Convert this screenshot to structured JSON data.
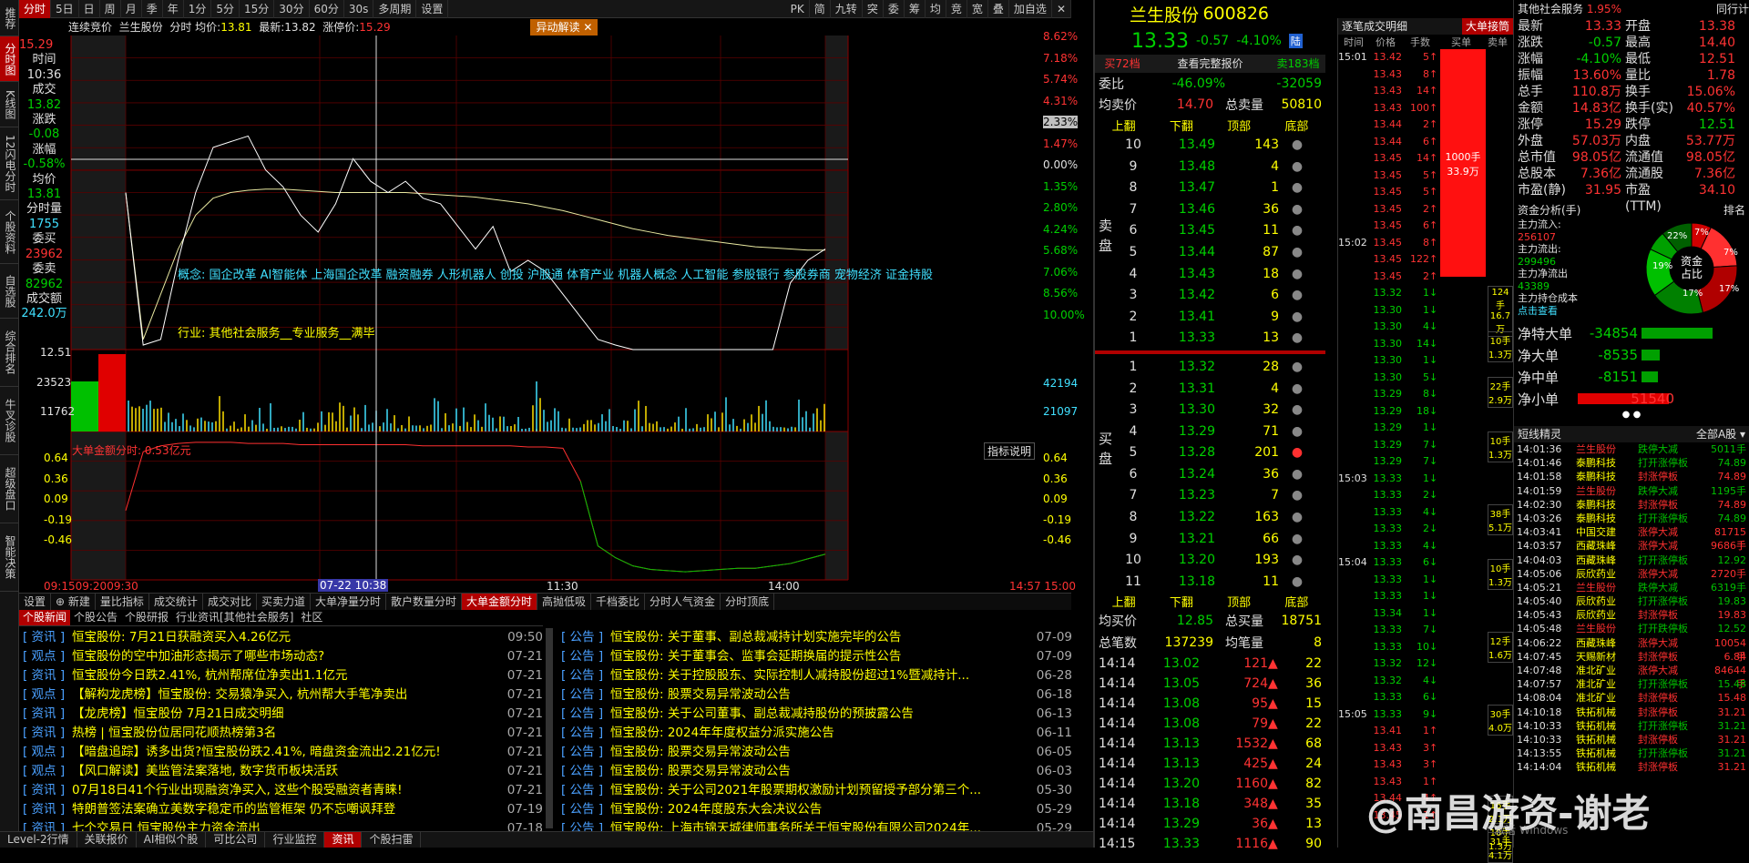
{
  "left_tabs": [
    "推荐",
    "分时图",
    "K线图",
    "12闪电分时",
    "个股资料",
    "自选股",
    "综合排名",
    "牛叉诊股",
    "超级盘口",
    "智能决策"
  ],
  "top_tabs": [
    "分时",
    "5日",
    "日",
    "周",
    "月",
    "季",
    "年",
    "1分",
    "5分",
    "15分",
    "30分",
    "60分",
    "30s",
    "多周期",
    "设置"
  ],
  "top_right_tabs": [
    "PK",
    "简",
    "九转",
    "突",
    "委",
    "筹",
    "均",
    "竞",
    "宽",
    "叠",
    "加自选"
  ],
  "infobar": {
    "mode": "连续竞价",
    "name": "兰生股份",
    "chart_kind": "分时",
    "avg_label": "均价:",
    "avg": "13.81",
    "last_label": "最新:",
    "last": "13.82",
    "limitup_label": "涨停价:",
    "limitup": "15.29",
    "alert": "异动解读"
  },
  "left_panel": {
    "time_label": "时间",
    "time": "10:36",
    "close_label": "成交",
    "close": "13.82",
    "chg_label": "涨跌",
    "chg": "-0.08",
    "pct_label": "涨幅",
    "pct": "-0.58%",
    "avg_label": "均价",
    "avg": "13.81",
    "vol_label": "分时量",
    "vol": "1755",
    "buy_label": "委买",
    "buy": "23962",
    "sell_label": "委卖",
    "sell": "82962",
    "amt_label": "成交额",
    "amt": "242.0万"
  },
  "price_axis_left": [
    "15.29",
    "12.51"
  ],
  "price_axis_right": [
    "8.62%",
    "7.18%",
    "5.74%",
    "4.31%",
    "2.33%",
    "1.47%",
    "0.00%",
    "1.35%",
    "2.80%",
    "4.24%",
    "5.68%",
    "7.06%",
    "8.56%",
    "10.00%"
  ],
  "vol_axis_left": [
    "23523",
    "11762"
  ],
  "vol_axis_right": [
    "42194",
    "21097"
  ],
  "concept_text": "概念: 国企改革 AI智能体 上海国企改革 融资融券 人形机器人 创投 沪股通 体育产业 机器人概念 人工智能 参股银行 参股券商 宠物经济 证金持股",
  "industry_text": "行业: 其他社会服务__专业服务__满毕",
  "indicator": {
    "title": "大单金额分时: 0.53亿元",
    "button": "指标说明",
    "left_axis": [
      "0.64",
      "0.36",
      "0.09",
      "-0.19",
      "-0.46"
    ],
    "right_axis": [
      "0.64",
      "0.36",
      "0.09",
      "-0.19",
      "-0.46"
    ]
  },
  "time_axis": {
    "start": "09:15",
    "t2": "09:20",
    "t3": "09:30",
    "cursor": "07-22 10:38",
    "t5": "11:30",
    "t6": "14:00",
    "end": "14:57",
    "end2": "15:00"
  },
  "sub_tabs": [
    "设置",
    "新建",
    "量比指标",
    "成交统计",
    "成交对比",
    "买卖力道",
    "大单净量分时",
    "散户数量分时",
    "大单金额分时",
    "高抛低吸",
    "千档委比",
    "分时人气资金",
    "分时顶底"
  ],
  "news_tabs": [
    "个股新闻",
    "个股公告",
    "个股研报",
    "行业资讯[其他社会服务]",
    "社区"
  ],
  "news_left": [
    {
      "tag": "[ 资讯 ]",
      "text": "恒宝股份: 7月21日获融资买入4.26亿元",
      "date": "09:50"
    },
    {
      "tag": "[ 观点 ]",
      "text": "恒宝股份的空中加油形态揭示了哪些市场动态?",
      "date": "07-21"
    },
    {
      "tag": "[ 资讯 ]",
      "text": "恒宝股份今日跌2.41%, 杭州帮席位净卖出1.1亿元",
      "date": "07-21"
    },
    {
      "tag": "[ 观点 ]",
      "text": "【解构龙虎榜】恒宝股份: 交易猿净买入, 杭州帮大手笔净卖出",
      "date": "07-21"
    },
    {
      "tag": "[ 资讯 ]",
      "text": "【龙虎榜】恒宝股份 7月21日成交明细",
      "date": "07-21"
    },
    {
      "tag": "[ 资讯 ]",
      "text": "热榜 | 恒宝股份位居同花顺热榜第3名",
      "date": "07-21"
    },
    {
      "tag": "[ 观点 ]",
      "text": "【暗盘追踪】诱多出货?恒宝股份跌2.41%, 暗盘资金流出2.21亿元!",
      "date": "07-21"
    },
    {
      "tag": "[ 观点 ]",
      "text": "【风口解读】美监管法案落地, 数字货币板块活跃",
      "date": "07-21"
    },
    {
      "tag": "[ 资讯 ]",
      "text": "07月18日41个行业出现融资净买入, 这些个股受融资者青睐!",
      "date": "07-21"
    },
    {
      "tag": "[ 资讯 ]",
      "text": "特朗普签法案确立美数字稳定币的监管框架 仍不忘嘲讽拜登",
      "date": "07-19"
    },
    {
      "tag": "[ 资讯 ]",
      "text": "七个交易日 恒宝股份主力资金流出",
      "date": "07-18"
    }
  ],
  "news_right": [
    {
      "tag": "[ 公告 ]",
      "text": "恒宝股份: 关于董事、副总裁减持计划实施完毕的公告",
      "date": "07-09"
    },
    {
      "tag": "[ 公告 ]",
      "text": "恒宝股份: 关于董事会、监事会延期换届的提示性公告",
      "date": "07-09"
    },
    {
      "tag": "[ 公告 ]",
      "text": "恒宝股份: 关于控股股东、实际控制人减持股份超过1%暨减持计...",
      "date": "06-28"
    },
    {
      "tag": "[ 公告 ]",
      "text": "恒宝股份: 股票交易异常波动公告",
      "date": "06-18"
    },
    {
      "tag": "[ 公告 ]",
      "text": "恒宝股份: 关于公司董事、副总裁减持股份的预披露公告",
      "date": "06-13"
    },
    {
      "tag": "[ 公告 ]",
      "text": "恒宝股份: 2024年年度权益分派实施公告",
      "date": "06-11"
    },
    {
      "tag": "[ 公告 ]",
      "text": "恒宝股份: 股票交易异常波动公告",
      "date": "06-05"
    },
    {
      "tag": "[ 公告 ]",
      "text": "恒宝股份: 股票交易异常波动公告",
      "date": "06-03"
    },
    {
      "tag": "[ 公告 ]",
      "text": "恒宝股份: 关于公司2021年股票期权激励计划预留授予部分第三个...",
      "date": "05-30"
    },
    {
      "tag": "[ 公告 ]",
      "text": "恒宝股份: 2024年度股东大会决议公告",
      "date": "05-29"
    },
    {
      "tag": "[ 公告 ]",
      "text": "恒宝股份: 上海市锦天城律师事务所关于恒宝股份有限公司2024年...",
      "date": "05-29"
    }
  ],
  "bottom_tabs": [
    "Level-2行情",
    "关联报价",
    "AI相似个股",
    "可比公司",
    "行业监控",
    "资讯",
    "个股扫雷"
  ],
  "quote": {
    "name": "兰生股份",
    "code": "600826",
    "price": "13.33",
    "chg": "-0.57",
    "pct": "-4.10%",
    "tag": "陆",
    "btn_buy": "买72档",
    "btn_full": "查看完整报价",
    "btn_sell": "卖183档",
    "wb_label": "委比",
    "wb": "-46.09%",
    "wb_val": "-32059",
    "avg_sell_label": "均卖价",
    "avg_sell": "14.70",
    "total_sell_label": "总卖量",
    "total_sell": "50810",
    "nav": [
      "上翻",
      "下翻",
      "顶部",
      "底部"
    ],
    "sells": [
      [
        "10",
        "13.49",
        "143"
      ],
      [
        "9",
        "13.48",
        "4"
      ],
      [
        "8",
        "13.47",
        "1"
      ],
      [
        "7",
        "13.46",
        "36"
      ],
      [
        "6",
        "13.45",
        "11"
      ],
      [
        "5",
        "13.44",
        "87"
      ],
      [
        "4",
        "13.43",
        "18"
      ],
      [
        "3",
        "13.42",
        "6"
      ],
      [
        "2",
        "13.41",
        "9"
      ],
      [
        "1",
        "13.33",
        "13"
      ]
    ],
    "buys": [
      [
        "1",
        "13.32",
        "28"
      ],
      [
        "2",
        "13.31",
        "4"
      ],
      [
        "3",
        "13.30",
        "32"
      ],
      [
        "4",
        "13.29",
        "71"
      ],
      [
        "5",
        "13.28",
        "201"
      ],
      [
        "6",
        "13.24",
        "36"
      ],
      [
        "7",
        "13.23",
        "7"
      ],
      [
        "8",
        "13.22",
        "163"
      ],
      [
        "9",
        "13.21",
        "66"
      ],
      [
        "10",
        "13.20",
        "193"
      ],
      [
        "11",
        "13.18",
        "11"
      ]
    ],
    "sell_label": "卖盘",
    "buy_label": "买盘",
    "avg_buy_label": "均买价",
    "avg_buy": "12.85",
    "total_buy_label": "总买量",
    "total_buy": "18751",
    "total_count_label": "总笔数",
    "total_count": "137239",
    "avg_count_label": "均笔量",
    "avg_count": "8",
    "trades": [
      [
        "14:14",
        "13.02",
        "121",
        "22"
      ],
      [
        "14:14",
        "13.05",
        "724",
        "36"
      ],
      [
        "14:14",
        "13.08",
        "95",
        "15"
      ],
      [
        "14:14",
        "13.08",
        "79",
        "22"
      ],
      [
        "14:14",
        "13.13",
        "1532",
        "68"
      ],
      [
        "14:14",
        "13.13",
        "425",
        "24"
      ],
      [
        "14:14",
        "13.20",
        "1160",
        "82"
      ],
      [
        "14:14",
        "13.18",
        "348",
        "35"
      ],
      [
        "14:14",
        "13.29",
        "36",
        "13"
      ],
      [
        "14:15",
        "13.33",
        "1116",
        "90"
      ]
    ]
  },
  "ticks": {
    "title": "逐笔成交明细",
    "title2": "大单接筒",
    "headers": [
      "时间",
      "价格",
      "手数",
      "买单",
      "卖单"
    ],
    "rows": [
      [
        "15:01",
        "13.42",
        "5"
      ],
      [
        "",
        "13.43",
        "8"
      ],
      [
        "",
        "13.43",
        "14"
      ],
      [
        "",
        "13.43",
        "100"
      ],
      [
        "",
        "13.44",
        "2"
      ],
      [
        "",
        "13.44",
        "6"
      ],
      [
        "",
        "13.45",
        "14"
      ],
      [
        "",
        "13.45",
        "5"
      ],
      [
        "",
        "13.45",
        "5"
      ],
      [
        "",
        "13.45",
        "2"
      ],
      [
        "",
        "13.45",
        "6"
      ],
      [
        "15:02",
        "13.45",
        "8"
      ],
      [
        "",
        "13.45",
        "122"
      ],
      [
        "",
        "13.45",
        "2"
      ],
      [
        "",
        "13.32",
        "1"
      ],
      [
        "",
        "13.30",
        "1"
      ],
      [
        "",
        "13.30",
        "4"
      ],
      [
        "",
        "13.30",
        "14"
      ],
      [
        "",
        "13.30",
        "1"
      ],
      [
        "",
        "13.30",
        "5"
      ],
      [
        "",
        "13.29",
        "8"
      ],
      [
        "",
        "13.29",
        "18"
      ],
      [
        "",
        "13.29",
        "1"
      ],
      [
        "",
        "13.29",
        "7"
      ],
      [
        "",
        "13.29",
        "7"
      ],
      [
        "15:03",
        "13.33",
        "1"
      ],
      [
        "",
        "13.33",
        "2"
      ],
      [
        "",
        "13.33",
        "4"
      ],
      [
        "",
        "13.33",
        "2"
      ],
      [
        "",
        "13.33",
        "4"
      ],
      [
        "15:04",
        "13.33",
        "6"
      ],
      [
        "",
        "13.33",
        "1"
      ],
      [
        "",
        "13.33",
        "1"
      ],
      [
        "",
        "13.34",
        "1"
      ],
      [
        "",
        "13.33",
        "7"
      ],
      [
        "",
        "13.33",
        "10"
      ],
      [
        "",
        "13.32",
        "12"
      ],
      [
        "",
        "13.32",
        "4"
      ],
      [
        "",
        "13.33",
        "6"
      ],
      [
        "15:05",
        "13.33",
        "9"
      ],
      [
        "",
        "13.41",
        "1"
      ],
      [
        "",
        "13.43",
        "3"
      ],
      [
        "",
        "13.43",
        "3"
      ],
      [
        "",
        "13.43",
        "1"
      ],
      [
        "",
        "13.44",
        "4"
      ],
      [
        "",
        "13.45",
        "1"
      ]
    ],
    "big": [
      [
        "1000手",
        "33.9万"
      ],
      [
        "124手",
        "16.7万"
      ],
      [
        "10手",
        "1.3万"
      ],
      [
        "22手",
        "2.9万"
      ],
      [
        "10手",
        "1.3万"
      ],
      [
        "38手",
        "5.1万"
      ],
      [
        "10手",
        "1.3万"
      ],
      [
        "12手",
        "1.6万"
      ],
      [
        "30手",
        "4.0万"
      ],
      [
        "16手",
        "2.1万"
      ],
      [
        "10手",
        "1.3万"
      ],
      [
        "31手",
        "4.1万"
      ]
    ]
  },
  "right": {
    "top_label": "其他社会服务",
    "top_pct": "1.95%",
    "top_label2": "同行计",
    "kv": [
      [
        "最新",
        "13.33",
        "开盘",
        "13.38"
      ],
      [
        "涨跌",
        "-0.57",
        "最高",
        "14.40"
      ],
      [
        "涨幅",
        "-4.10%",
        "最低",
        "12.51"
      ],
      [
        "振幅",
        "13.60%",
        "量比",
        "1.78"
      ],
      [
        "总手",
        "110.8万",
        "换手",
        "15.06%"
      ],
      [
        "金额",
        "14.83亿",
        "换手(实)",
        "40.57%"
      ],
      [
        "涨停",
        "15.29",
        "跌停",
        "12.51"
      ],
      [
        "外盘",
        "57.03万",
        "内盘",
        "53.77万"
      ],
      [
        "总市值",
        "98.05亿",
        "流通值",
        "98.05亿"
      ],
      [
        "总股本",
        "7.36亿",
        "流通股",
        "7.36亿"
      ],
      [
        "市盈(静)",
        "31.95",
        "市盈(TTM)",
        "34.10"
      ]
    ],
    "fund_title": "资金分析(手)",
    "fund_rank": "排名",
    "fund_items": [
      [
        "主力流入:",
        "256107"
      ],
      [
        "主力流出:",
        "299496"
      ],
      [
        "主力净流出",
        "43389"
      ],
      [
        "主力持仓成本",
        "点击查看"
      ]
    ],
    "pie_center": [
      "资金",
      "占比"
    ],
    "pie_labels": [
      "7%",
      "7%",
      "17%",
      "17%",
      "19%",
      "22%"
    ],
    "net": [
      [
        "净特大单",
        "-34854"
      ],
      [
        "净大单",
        "-8535"
      ],
      [
        "净中单",
        "-8151"
      ],
      [
        "净小单",
        "51540"
      ]
    ],
    "elf_title": "短线精灵",
    "elf_filter": "全部A股",
    "elf_rows": [
      [
        "14:01:36",
        "兰生股份",
        "跌停大减",
        "5011手"
      ],
      [
        "14:01:46",
        "泰鹏科技",
        "打开涨停板",
        "74.89"
      ],
      [
        "14:01:58",
        "泰鹏科技",
        "封涨停板",
        "74.89"
      ],
      [
        "14:01:59",
        "兰生股份",
        "跌停大减",
        "1195手"
      ],
      [
        "14:02:30",
        "泰鹏科技",
        "封涨停板",
        "74.89"
      ],
      [
        "14:03:26",
        "泰鹏科技",
        "打开涨停板",
        "74.89"
      ],
      [
        "14:03:41",
        "中国交建",
        "涨停大减",
        "81715手"
      ],
      [
        "14:03:57",
        "西藏珠峰",
        "涨停大减",
        "9686手"
      ],
      [
        "14:04:03",
        "西藏珠峰",
        "打开涨停板",
        "12.92"
      ],
      [
        "14:05:06",
        "辰欣药业",
        "涨停大减",
        "2720手"
      ],
      [
        "14:05:21",
        "兰生股份",
        "跌停大减",
        "6319手"
      ],
      [
        "14:05:40",
        "辰欣药业",
        "打开涨停板",
        "19.83"
      ],
      [
        "14:05:43",
        "辰欣药业",
        "封涨停板",
        "19.83"
      ],
      [
        "14:05:48",
        "兰生股份",
        "打开跌停板",
        "12.52"
      ],
      [
        "14:06:22",
        "西藏珠峰",
        "涨停大减",
        "10054手"
      ],
      [
        "14:07:45",
        "天赐新材",
        "封涨停板",
        "6.84"
      ],
      [
        "14:07:48",
        "准北矿业",
        "涨停大减",
        "84644手"
      ],
      [
        "14:07:57",
        "准北矿业",
        "打开涨停板",
        "15.48"
      ],
      [
        "14:08:04",
        "准北矿业",
        "封涨停板",
        "15.48"
      ],
      [
        "14:10:18",
        "铁拓机械",
        "封涨停板",
        "31.21"
      ],
      [
        "14:10:33",
        "铁拓机械",
        "打开涨停板",
        "31.21"
      ],
      [
        "14:10:33",
        "铁拓机械",
        "封涨停板",
        "31.21"
      ],
      [
        "14:13:55",
        "铁拓机械",
        "打开涨停板",
        "31.21"
      ],
      [
        "14:14:04",
        "铁拓机械",
        "封涨停板",
        "31.21"
      ]
    ]
  },
  "watermark": "@南昌游资-谢老",
  "watermark2": "激活 Windows",
  "chart_data": {
    "type": "line",
    "title": "兰生股份 分时",
    "price_series": [
      13.9,
      12.55,
      12.6,
      13.3,
      13.9,
      14.3,
      14.35,
      14.4,
      14.1,
      13.95,
      13.7,
      13.55,
      13.8,
      14.2,
      14.0,
      13.9,
      14.0,
      13.85,
      13.8,
      13.6,
      13.4,
      13.6,
      13.2,
      13.3,
      13.2,
      13.0,
      12.8,
      12.6,
      12.55,
      12.51,
      12.51,
      12.51,
      12.51,
      12.51,
      12.51,
      12.51,
      12.51,
      12.51,
      13.1,
      13.3,
      13.4
    ],
    "avg_series": [
      13.9,
      12.6,
      13.0,
      13.4,
      13.7,
      13.85,
      13.9,
      13.92,
      13.93,
      13.93,
      13.92,
      13.91,
      13.9,
      13.9,
      13.9,
      13.9,
      13.9,
      13.89,
      13.88,
      13.87,
      13.86,
      13.84,
      13.82,
      13.8,
      13.77,
      13.74,
      13.7,
      13.66,
      13.62,
      13.58,
      13.55,
      13.52,
      13.5,
      13.48,
      13.46,
      13.44,
      13.42,
      13.41,
      13.4,
      13.39,
      13.39
    ],
    "ylim": [
      12.51,
      15.29
    ],
    "x_labels": [
      "09:30",
      "10:30",
      "11:30",
      "14:00",
      "15:00"
    ],
    "indicator_series": [
      0.05,
      0.55,
      0.6,
      0.62,
      0.63,
      0.63,
      0.63,
      0.62,
      0.62,
      0.62,
      0.61,
      0.61,
      0.61,
      0.61,
      0.61,
      0.61,
      0.61,
      0.6,
      0.6,
      0.6,
      0.6,
      0.6,
      0.6,
      0.59,
      0.59,
      0.58,
      0.3,
      -0.25,
      -0.35,
      -0.42,
      -0.45,
      -0.46,
      -0.47,
      -0.46,
      -0.45,
      -0.44,
      -0.44,
      -0.42,
      -0.4,
      -0.36,
      -0.32
    ],
    "indicator_ylim": [
      -0.5,
      0.66
    ]
  }
}
